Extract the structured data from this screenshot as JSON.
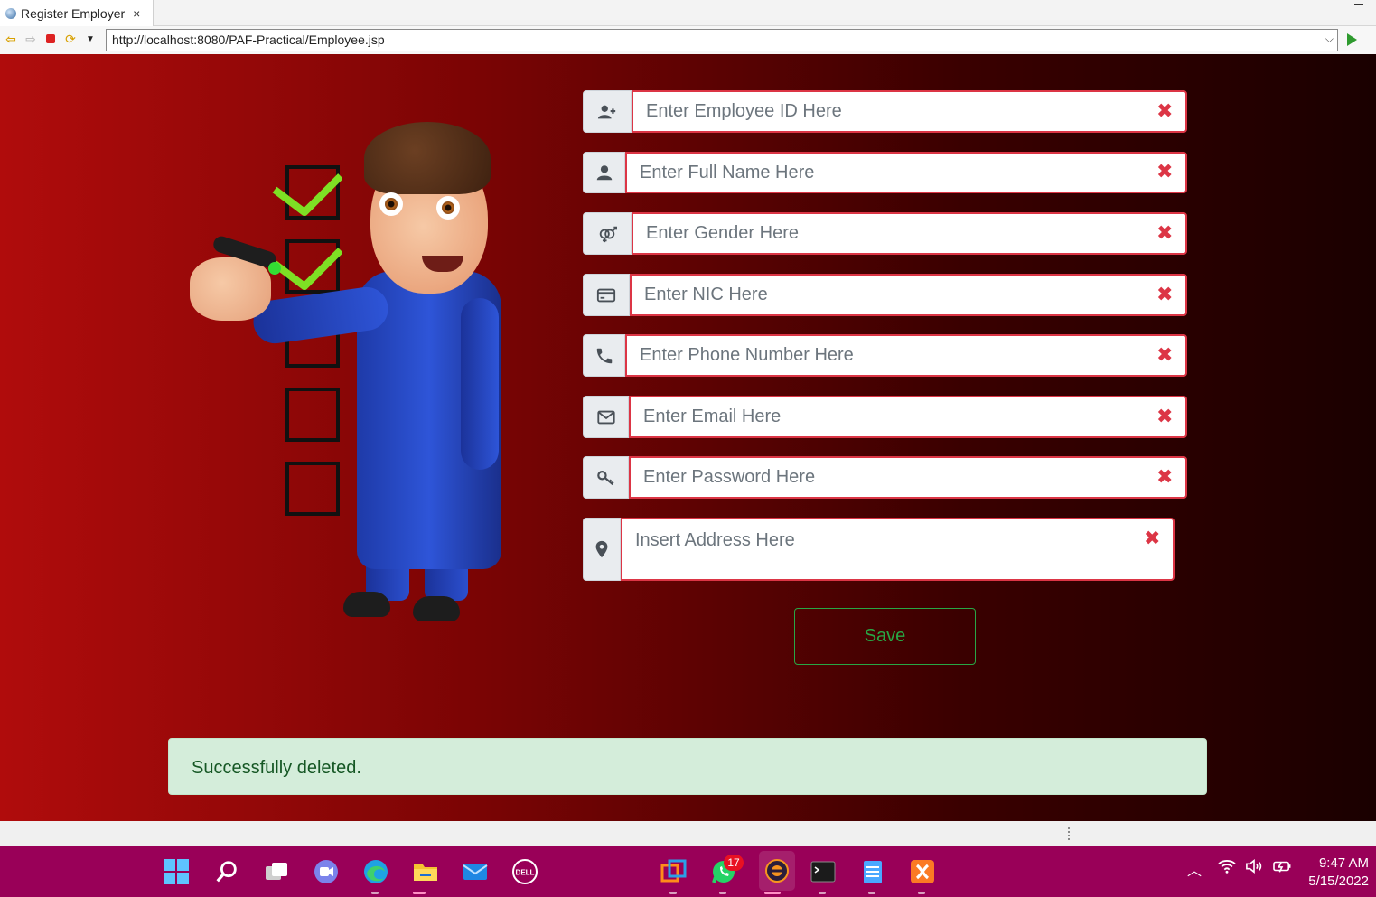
{
  "browser": {
    "tab_title": "Register Employer",
    "tab_close": "×",
    "url": "http://localhost:8080/PAF-Practical/Employee.jsp"
  },
  "form": {
    "fields": [
      {
        "placeholder": "Enter Employee ID Here",
        "icon": "user-plus-icon"
      },
      {
        "placeholder": "Enter Full Name Here",
        "icon": "user-icon"
      },
      {
        "placeholder": "Enter Gender Here",
        "icon": "gender-icon"
      },
      {
        "placeholder": "Enter NIC Here",
        "icon": "id-card-icon"
      },
      {
        "placeholder": "Enter Phone Number Here",
        "icon": "phone-icon"
      },
      {
        "placeholder": "Enter Email Here",
        "icon": "envelope-icon"
      },
      {
        "placeholder": "Enter Password Here",
        "icon": "key-icon"
      },
      {
        "placeholder": "Insert Address Here",
        "icon": "map-marker-icon"
      }
    ],
    "clear_glyph": "✖",
    "save_label": "Save"
  },
  "alert": {
    "message": "Successfully deleted."
  },
  "taskbar": {
    "whatsapp_badge": "17",
    "time": "9:47 AM",
    "date": "5/15/2022"
  },
  "colors": {
    "accent_red": "#dc3545",
    "success_green": "#28a745",
    "alert_bg": "#d4edda",
    "taskbar_bg": "#990058"
  }
}
